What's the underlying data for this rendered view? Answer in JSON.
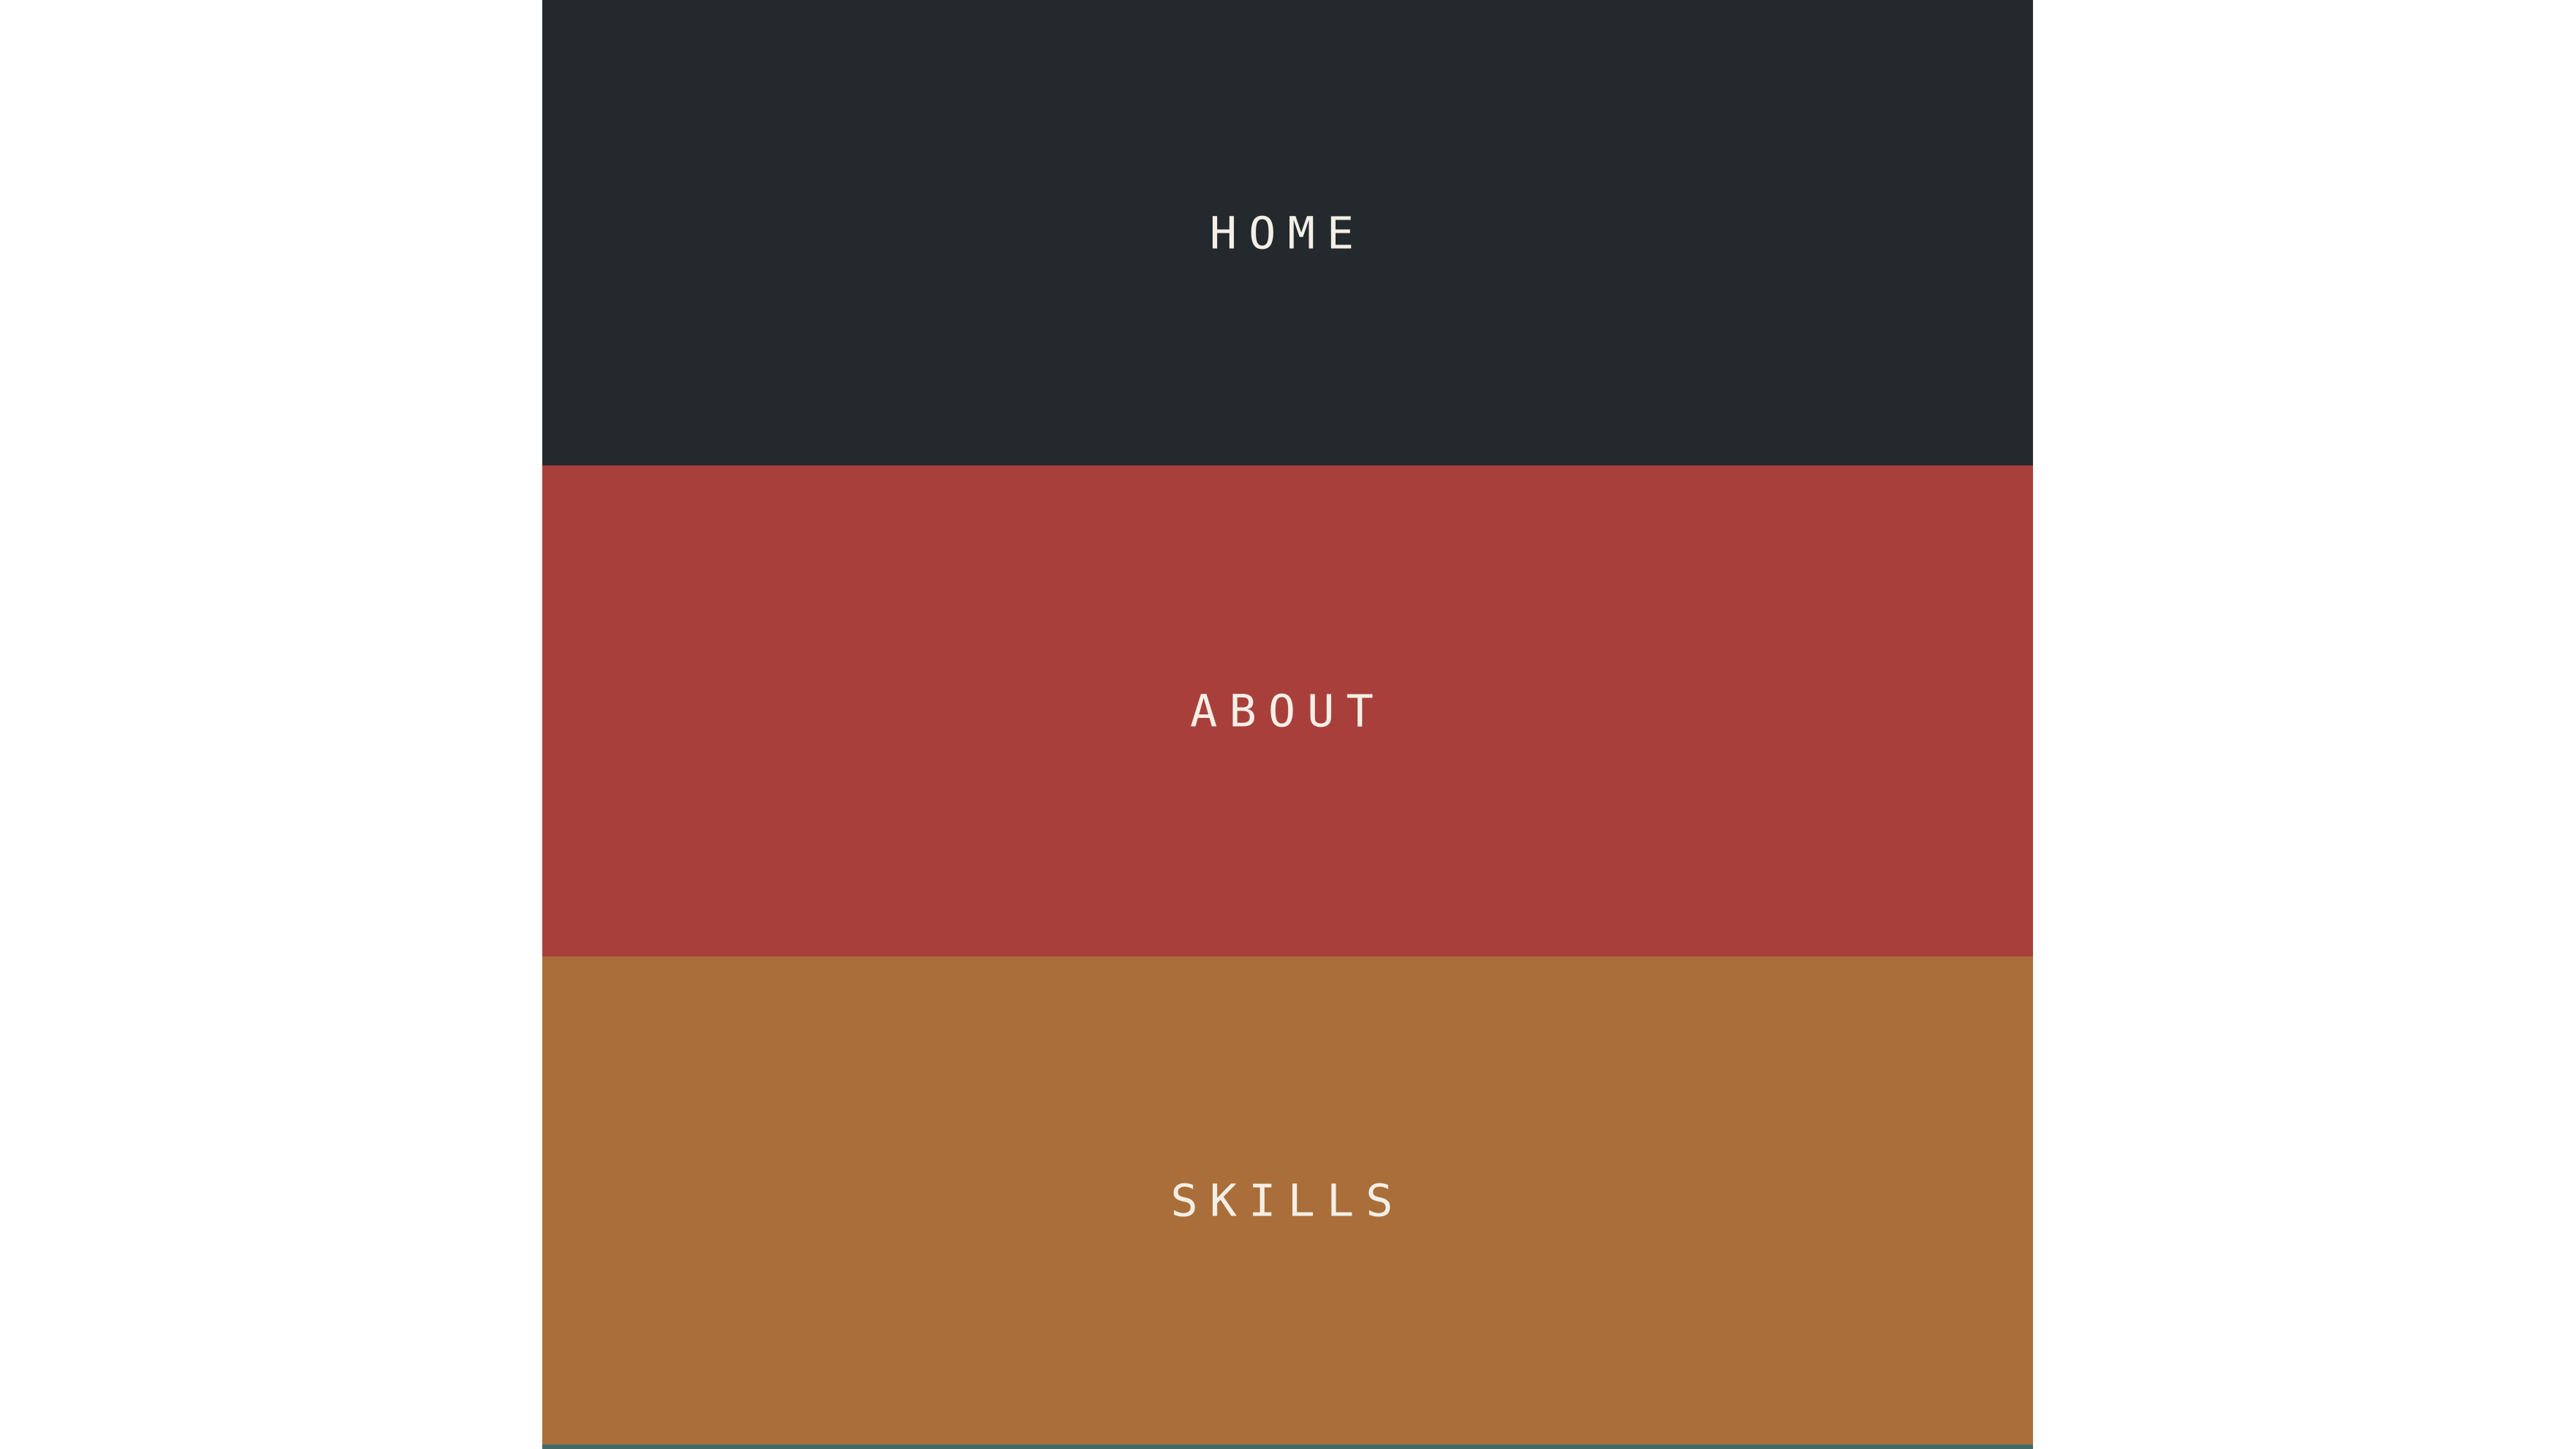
{
  "colors": {
    "page_background": "#ffffff",
    "label_text": "#f3efe6",
    "next_section_strip": "#3f6a6c"
  },
  "menu": {
    "items": [
      {
        "label": "HOME",
        "background": "#23292c"
      },
      {
        "label": "ABOUT",
        "background": "#a93f3b"
      },
      {
        "label": "SKILLS",
        "background": "#a96e39"
      }
    ]
  }
}
